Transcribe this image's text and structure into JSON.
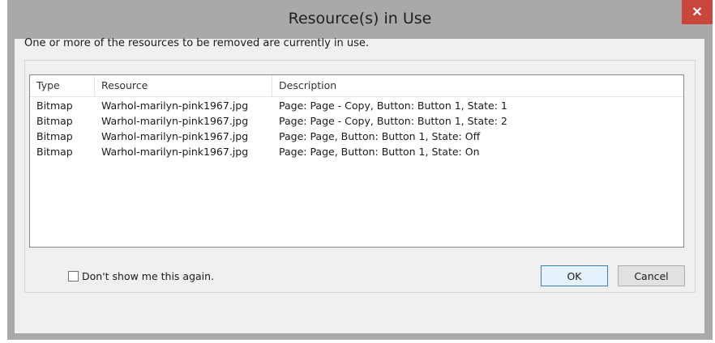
{
  "window": {
    "title": "Resource(s) in Use",
    "close_glyph": "✕"
  },
  "message": "One or more of the resources to be removed are currently in use.",
  "table": {
    "columns": [
      "Type",
      "Resource",
      "Description"
    ],
    "rows": [
      [
        "Bitmap",
        "Warhol-marilyn-pink1967.jpg",
        "Page: Page - Copy, Button: Button 1, State: 1"
      ],
      [
        "Bitmap",
        "Warhol-marilyn-pink1967.jpg",
        "Page: Page - Copy, Button: Button 1, State: 2"
      ],
      [
        "Bitmap",
        "Warhol-marilyn-pink1967.jpg",
        "Page: Page, Button: Button 1, State: Off"
      ],
      [
        "Bitmap",
        "Warhol-marilyn-pink1967.jpg",
        "Page: Page, Button: Button 1, State: On"
      ]
    ]
  },
  "checkbox": {
    "label": "Don't show me this again.",
    "checked": false
  },
  "buttons": {
    "ok": "OK",
    "cancel": "Cancel"
  },
  "colors": {
    "close": "#c9463d",
    "chrome": "#a9a9a9",
    "client": "#f0f0f0"
  }
}
